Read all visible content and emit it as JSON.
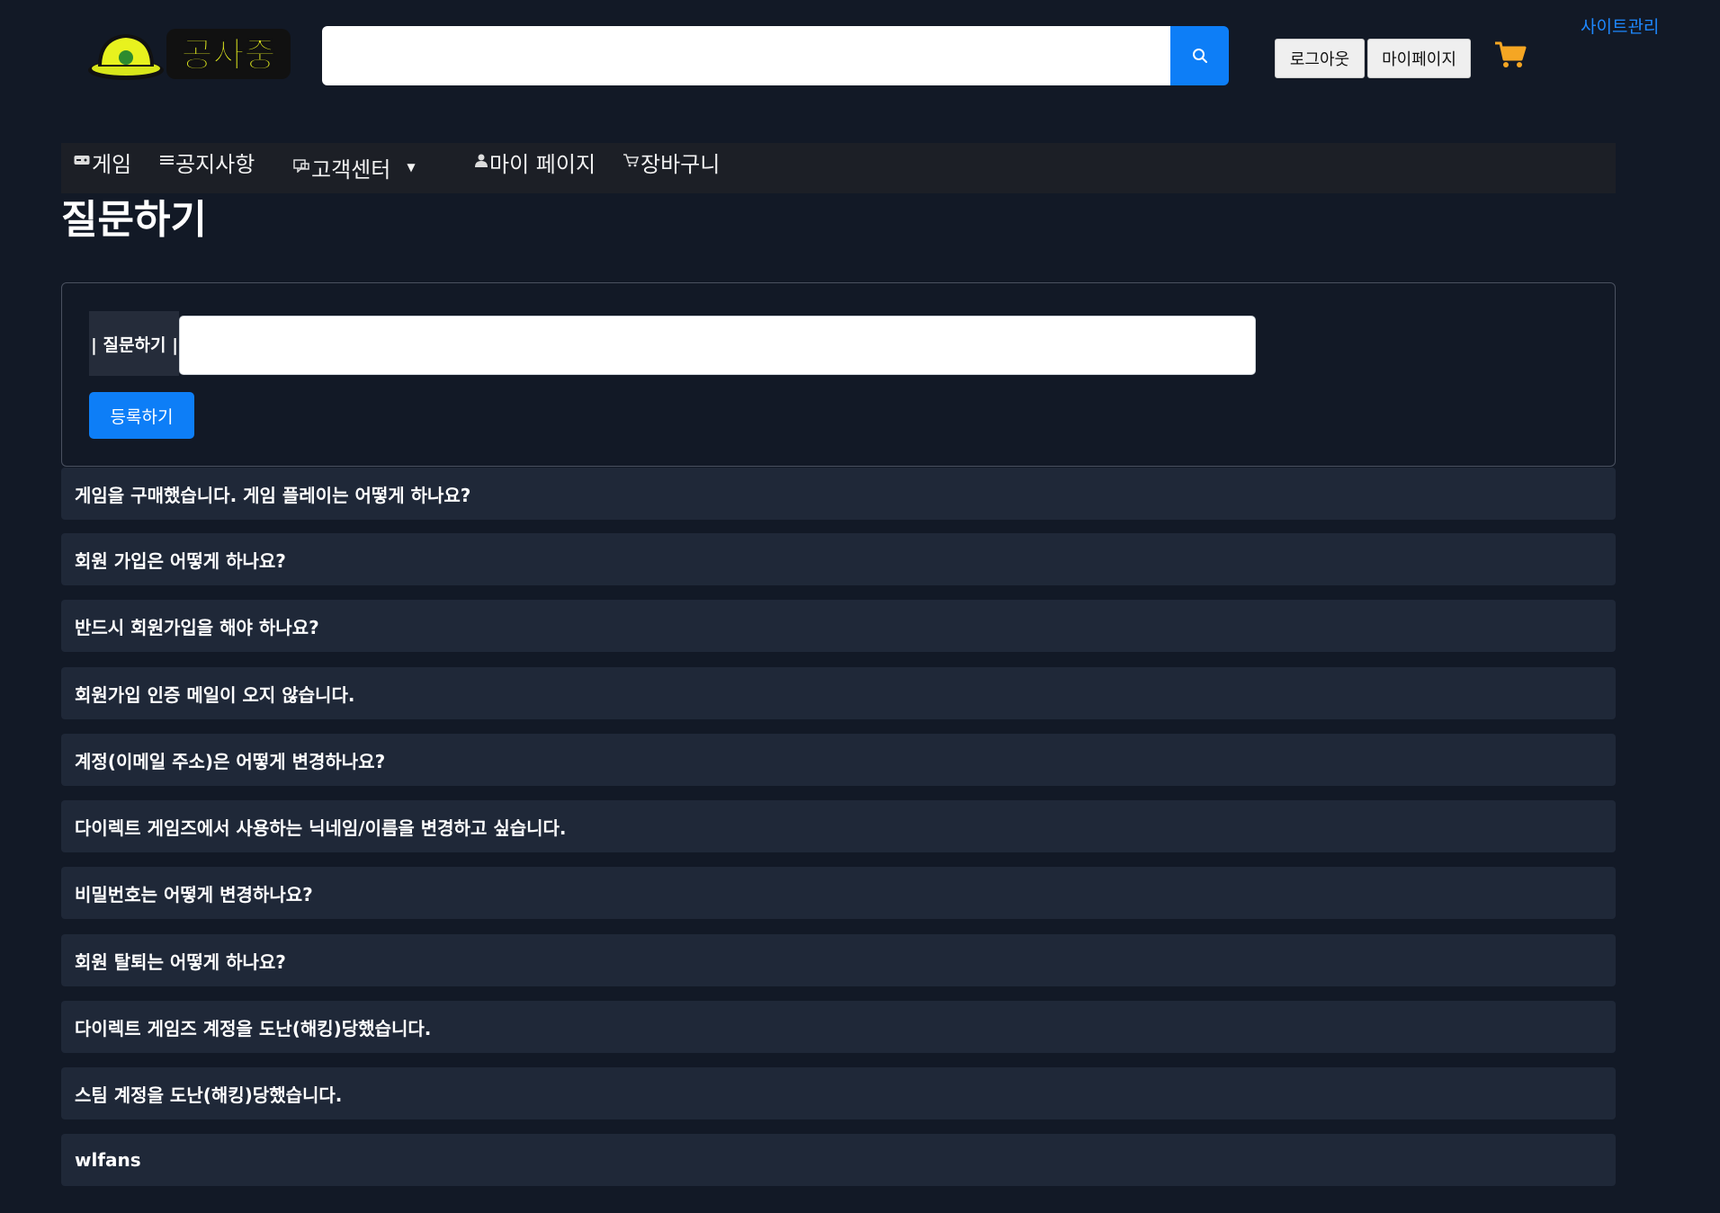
{
  "header": {
    "logo_text": "공사중",
    "search_value": "",
    "logout_label": "로그아웃",
    "mypage_label": "마이페이지",
    "admin_label": "사이트관리",
    "accent_color": "#0d7ef7",
    "cart_color": "#f5a623"
  },
  "nav": {
    "items": [
      {
        "icon": "gamepad-icon",
        "glyph": "▭",
        "label": "게임"
      },
      {
        "icon": "list-icon",
        "glyph": "≣",
        "label": "공지사항"
      },
      {
        "icon": "chat-icon",
        "glyph": "◻",
        "label": "고객센터"
      },
      {
        "icon": "user-icon",
        "glyph": "●",
        "label": "마이 페이지"
      },
      {
        "icon": "cart-icon",
        "glyph": "⊻",
        "label": "장바구니"
      }
    ]
  },
  "page": {
    "title": "질문하기"
  },
  "ask_form": {
    "label": "| 질문하기 |",
    "value": "",
    "submit_label": "등록하기"
  },
  "faq": {
    "items": [
      "게임을 구매했습니다. 게임 플레이는 어떻게 하나요?",
      "회원 가입은 어떻게 하나요?",
      "반드시 회원가입을 해야 하나요?",
      "회원가입 인증 메일이 오지 않습니다.",
      "계정(이메일 주소)은 어떻게 변경하나요?",
      "다이렉트 게임즈에서 사용하는 닉네임/이름을 변경하고 싶습니다.",
      "비밀번호는 어떻게 변경하나요?",
      "회원 탈퇴는 어떻게 하나요?",
      "다이렉트 게임즈 계정을 도난(해킹)당했습니다.",
      "스팀 계정을 도난(해킹)당했습니다.",
      "wlfans"
    ]
  }
}
